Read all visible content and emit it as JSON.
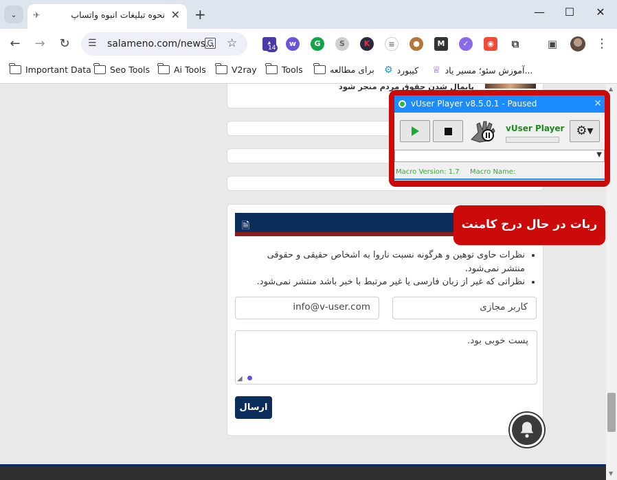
{
  "browser": {
    "tab_title": "نحوه تبلیغات انبوه واتساپ",
    "url": "salameno.com/news...",
    "ext_badge": "14",
    "bookmarks": [
      {
        "label": "Important Data",
        "type": "folder"
      },
      {
        "label": "Seo Tools",
        "type": "folder"
      },
      {
        "label": "Ai Tools",
        "type": "folder"
      },
      {
        "label": "V2ray",
        "type": "folder"
      },
      {
        "label": "Tools",
        "type": "folder"
      },
      {
        "label": "برای مطالعه",
        "type": "folder"
      },
      {
        "label": "کیبورد",
        "type": "link"
      },
      {
        "label": "آموزش سئو؛ مسیر یاد...",
        "type": "link"
      }
    ]
  },
  "page": {
    "comment_text": "پایمال شدن حقوق مردم منجر شود",
    "rules": [
      "نظرات حاوی توهین و هرگونه نسبت ناروا به اشخاص حقیقی و حقوقی منتشر نمی‌شود.",
      "نظراتی که غیر از زبان فارسی یا غیر مرتبط با خبر باشد منتشر نمی‌شود."
    ],
    "name_value": "کاربر مجازی",
    "email_value": "info@v-user.com",
    "comment_value": "پست خوبی بود.",
    "submit_label": "ارسال"
  },
  "vuser": {
    "title": "vUser Player v8.5.0.1 - Paused",
    "name": "vUser Player",
    "macro_version": "Macro Version: 1.7",
    "macro_name": "Macro Name:"
  },
  "callout": {
    "text": "ربات در حال درج کامنت"
  },
  "colors": {
    "accent_navy": "#0b2d5c",
    "accent_red": "#cc0a0a",
    "vuser_blue": "#1a8cff"
  }
}
